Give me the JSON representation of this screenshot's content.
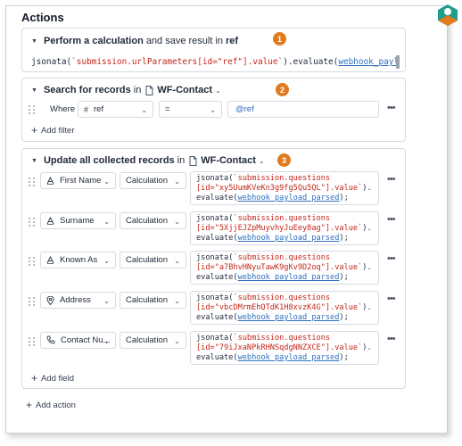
{
  "title": "Actions",
  "colors": {
    "accent_orange": "#e07b1f",
    "string_red": "#c4271b",
    "variable_blue": "#2f6fbd",
    "badge_teal": "#2aa198"
  },
  "steps": [
    {
      "number": "1",
      "header": {
        "prefix": "Perform a calculation",
        "middle": "and save result in",
        "target": "ref"
      },
      "code": {
        "fn": "jsonata(",
        "str": "`submission.urlParameters[id=\"ref\"].value`",
        "mid": ").evaluate(",
        "var": "webhook_payload_parsed",
        "end": ");"
      }
    },
    {
      "number": "2",
      "header": {
        "prefix": "Search for records",
        "middle": "in",
        "table": "WF-Contact"
      },
      "filter": {
        "where_label": "Where",
        "field": "ref",
        "operator": "=",
        "value": "@ref"
      },
      "add_filter_label": "Add filter"
    },
    {
      "number": "3",
      "header": {
        "prefix": "Update all collected records",
        "middle": "in",
        "table": "WF-Contact"
      },
      "fields": [
        {
          "icon": "text-icon",
          "name": "First Name",
          "mode": "Calculation",
          "l1": "jsonata(",
          "l1s": "`submission.questions",
          "l2": "[id=\"xy5UumKVeKn3g9fg5Qu5QL\"].value`",
          "l2e": ").",
          "l3": "evaluate(",
          "l3v": "webhook_payload_parsed",
          "l3e": ");"
        },
        {
          "icon": "text-icon",
          "name": "Surname",
          "mode": "Calculation",
          "l1": "jsonata(",
          "l1s": "`submission.questions",
          "l2": "[id=\"5XjjEJZpMuyvhyJuEey8ag\"].value`",
          "l2e": ").",
          "l3": "evaluate(",
          "l3v": "webhook_payload_parsed",
          "l3e": ");"
        },
        {
          "icon": "text-icon",
          "name": "Known As",
          "mode": "Calculation",
          "l1": "jsonata(",
          "l1s": "`submission.questions",
          "l2": "[id=\"a7BhvHNyuTawK9gKv9D2oq\"].value`",
          "l2e": ").",
          "l3": "evaluate(",
          "l3v": "webhook_payload_parsed",
          "l3e": ");"
        },
        {
          "icon": "location-pin-icon",
          "name": "Address",
          "mode": "Calculation",
          "l1": "jsonata(",
          "l1s": "`submission.questions",
          "l2": "[id=\"vbcDMrmEhQTdK1H8xvzK4G\"].value`",
          "l2e": ").",
          "l3": "evaluate(",
          "l3v": "webhook_payload_parsed",
          "l3e": ");"
        },
        {
          "icon": "phone-icon",
          "name": "Contact Nu...",
          "mode": "Calculation",
          "l1": "jsonata(",
          "l1s": "`submission.questions",
          "l2": "[id=\"79iJxaNPkRHNSqdgNNZXCE\"].value`",
          "l2e": ").",
          "l3": "evaluate(",
          "l3v": "webhook_payload_parsed",
          "l3e": ");"
        }
      ],
      "add_field_label": "Add field"
    }
  ],
  "add_action_label": "Add action",
  "more_label": "•••"
}
